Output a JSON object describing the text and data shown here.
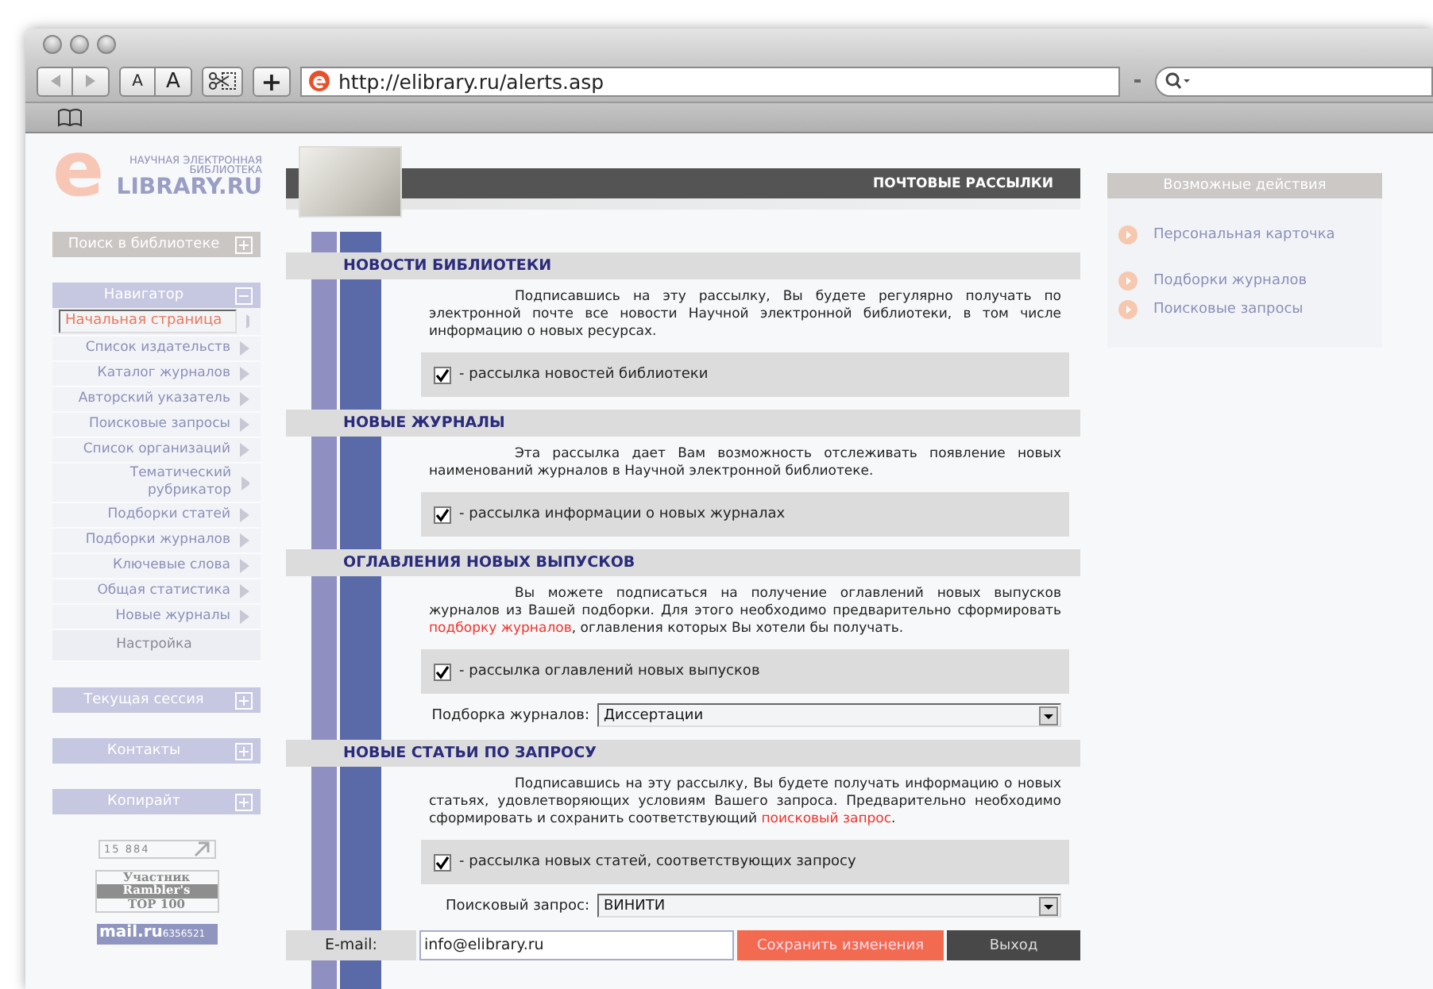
{
  "browser": {
    "font_small": "A",
    "font_large": "A",
    "add_button": "+",
    "url": "http://elibrary.ru/alerts.asp"
  },
  "sidebar": {
    "logo": {
      "mark": "e",
      "line1": "НАУЧНАЯ ЭЛЕКТРОННАЯ",
      "line2": "БИБЛИОТЕКА",
      "name": "LIBRARY.RU"
    },
    "panels": [
      {
        "title": "Поиск в библиотеке",
        "expanded": false,
        "color": "#c9c6c4"
      },
      {
        "title": "Навигатор",
        "expanded": true,
        "color": "#c6c7e0",
        "items": [
          {
            "label": "Начальная страница",
            "selected": true,
            "kind": "arrow"
          },
          {
            "label": "Список издательств",
            "selected": false,
            "kind": "arrow"
          },
          {
            "label": "Каталог журналов",
            "selected": false,
            "kind": "arrow"
          },
          {
            "label": "Авторский указатель",
            "selected": false,
            "kind": "arrow"
          },
          {
            "label": "Поисковые запросы",
            "selected": false,
            "kind": "arrow"
          },
          {
            "label": "Список организаций",
            "selected": false,
            "kind": "arrow"
          },
          {
            "label": "Тематический рубрикатор",
            "selected": false,
            "kind": "arrow"
          },
          {
            "label": "Подборки статей",
            "selected": false,
            "kind": "arrow"
          },
          {
            "label": "Подборки журналов",
            "selected": false,
            "kind": "arrow"
          },
          {
            "label": "Ключевые слова",
            "selected": false,
            "kind": "arrow"
          },
          {
            "label": "Общая статистика",
            "selected": false,
            "kind": "arrow"
          },
          {
            "label": "Новые журналы",
            "selected": false,
            "kind": "arrow"
          },
          {
            "label": "Настройка",
            "selected": false,
            "kind": "plain"
          }
        ]
      },
      {
        "title": "Текущая сессия",
        "expanded": false,
        "color": "#c6c7e0"
      },
      {
        "title": "Контакты",
        "expanded": false,
        "color": "#c6c7e0"
      },
      {
        "title": "Копирайт",
        "expanded": false,
        "color": "#c6c7e0"
      }
    ],
    "counters": [
      {
        "kind": "counter",
        "lines": [
          "15 884"
        ]
      },
      {
        "kind": "rambler",
        "lines": [
          "Участник",
          "Rambler's",
          "TOP 100"
        ]
      },
      {
        "kind": "mail",
        "lines": [
          "mail.ru",
          "6356521"
        ]
      }
    ]
  },
  "main": {
    "title": "ПОЧТОВЫЕ РАССЫЛКИ",
    "sections": [
      {
        "title": "НОВОСТИ БИБЛИОТЕКИ",
        "text": [
          {
            "text": "Подписавшись на эту рассылку, Вы будете регулярно получать по электронной почте все новости Научной электронной библиотеки, в том числе информацию о новых ресурсах.",
            "link": false
          }
        ],
        "checkbox": {
          "label": "- рассылка новостей библиотеки",
          "checked": true
        }
      },
      {
        "title": "НОВЫЕ ЖУРНАЛЫ",
        "text": [
          {
            "text": "Эта рассылка дает Вам возможность отслеживать появление новых наименований журналов в Научной электронной библиотеке.",
            "link": false
          }
        ],
        "checkbox": {
          "label": "- рассылка информации о новых журналах",
          "checked": true
        }
      },
      {
        "title": "ОГЛАВЛЕНИЯ НОВЫХ ВЫПУСКОВ",
        "text": [
          {
            "text": "Вы можете подписаться на получение оглавлений новых выпусков журналов из Вашей подборки. Для этого необходимо предварительно сформировать ",
            "link": false
          },
          {
            "text": "подборку журналов",
            "link": true
          },
          {
            "text": ", оглавления которых Вы хотели бы получать.",
            "link": false
          }
        ],
        "checkbox": {
          "label": "- рассылка оглавлений новых выпусков",
          "checked": true
        },
        "select": {
          "label": "Подборка журналов:",
          "value": "Диссертации"
        }
      },
      {
        "title": "НОВЫЕ СТАТЬИ ПО ЗАПРОСУ",
        "text": [
          {
            "text": "Подписавшись на эту рассылку, Вы будете получать информацию о новых статьях, удовлетворяющих условиям Вашего запроса. Предварительно необходимо сформировать и сохранить соответствующий ",
            "link": false
          },
          {
            "text": "поисковый запрос",
            "link": true
          },
          {
            "text": ".",
            "link": false
          }
        ],
        "checkbox": {
          "label": "- рассылка новых статей, соответствующих запросу",
          "checked": true
        },
        "select": {
          "label": "Поисковый запрос:",
          "value": "ВИНИТИ"
        }
      }
    ],
    "footer": {
      "email_label": "E-mail:",
      "email": "info@elibrary.ru",
      "save": "Сохранить изменения",
      "exit": "Выход"
    }
  },
  "actions": {
    "title": "Возможные действия",
    "groups": [
      [
        "Персональная карточка"
      ],
      [
        "Подборки журналов",
        "Поисковые запросы"
      ]
    ]
  }
}
